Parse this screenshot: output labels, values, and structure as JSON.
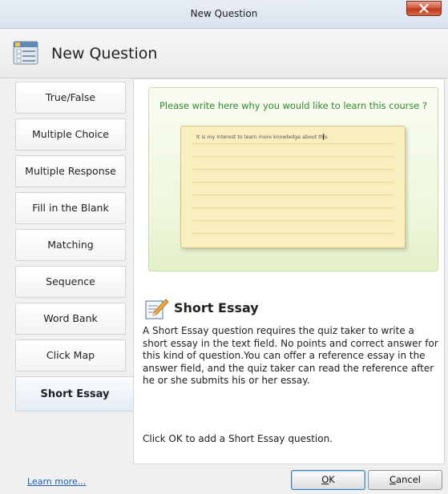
{
  "window": {
    "title": "New Question"
  },
  "header": {
    "title": "New Question",
    "icon": "question-form-icon"
  },
  "question_types": [
    {
      "label": "True/False",
      "active": false
    },
    {
      "label": "Multiple Choice",
      "active": false
    },
    {
      "label": "Multiple Response",
      "active": false
    },
    {
      "label": "Fill in the Blank",
      "active": false
    },
    {
      "label": "Matching",
      "active": false
    },
    {
      "label": "Sequence",
      "active": false
    },
    {
      "label": "Word Bank",
      "active": false
    },
    {
      "label": "Click Map",
      "active": false
    },
    {
      "label": "Short Essay",
      "active": true
    }
  ],
  "preview": {
    "caption": "Please write here why you would like to learn this course ?",
    "answer_text": "It is my interest to learn more knowledge about this"
  },
  "detail": {
    "icon": "pencil-note-icon",
    "title": "Short Essay",
    "description": "A Short Essay question requires the quiz taker to write a short essay in the text field. No points and correct answer for this kind of question.You can offer a reference essay in the answer field, and the quiz taker can read the reference after he or she submits his or her essay.",
    "instruction": "Click OK to add a Short Essay question."
  },
  "footer": {
    "learn_more": "Learn more...",
    "ok_prefix": "",
    "ok_mnemonic": "O",
    "ok_rest": "K",
    "cancel_mnemonic": "C",
    "cancel_rest": "ancel"
  },
  "colors": {
    "accent_green": "#2d8a2d",
    "link_blue": "#1a5fb4",
    "close_red": "#c1381b"
  }
}
